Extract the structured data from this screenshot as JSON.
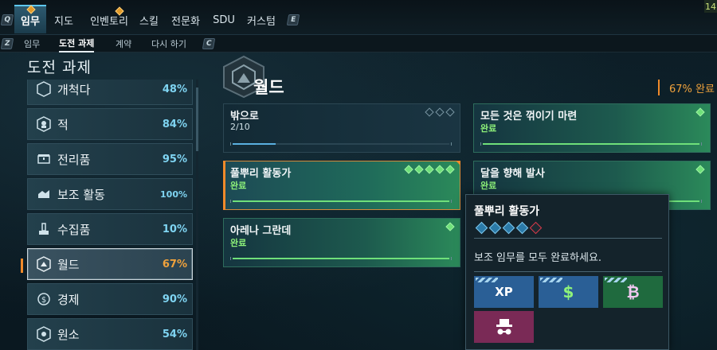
{
  "topnav": {
    "left_key": "Q",
    "right_key": "E",
    "corner": "14",
    "tabs": [
      "임무",
      "지도",
      "인벤토리",
      "스킬",
      "전문화",
      "SDU",
      "커스텀"
    ]
  },
  "subnav": {
    "left_key": "Z",
    "right_key": "C",
    "tabs": [
      "임무",
      "도전 과제",
      "계약",
      "다시 하기"
    ]
  },
  "section_title": "도전 과제",
  "categories": [
    {
      "label": "개척다",
      "pct": "48%",
      "icon": "pioneer-icon"
    },
    {
      "label": "적",
      "pct": "84%",
      "icon": "enemy-icon"
    },
    {
      "label": "전리품",
      "pct": "95%",
      "icon": "loot-icon"
    },
    {
      "label": "보조 활동",
      "pct": "100%",
      "icon": "side-activity-icon"
    },
    {
      "label": "수집품",
      "pct": "10%",
      "icon": "collectible-icon"
    },
    {
      "label": "월드",
      "pct": "67%",
      "icon": "world-icon"
    },
    {
      "label": "경제",
      "pct": "90%",
      "icon": "economy-icon"
    },
    {
      "label": "원소",
      "pct": "54%",
      "icon": "element-icon"
    }
  ],
  "zone": {
    "title": "월드",
    "completion": "67% 완료"
  },
  "challenges": [
    {
      "title": "밖으로",
      "sub": "2/10",
      "progress": 0.2,
      "pips": [
        false,
        false,
        false
      ],
      "state": "progress"
    },
    {
      "title": "모든 것은 꺾이기 마련",
      "sub": "완료",
      "progress": 1,
      "pips": [
        true
      ],
      "state": "done"
    },
    {
      "title": "풀뿌리 활동가",
      "sub": "완료",
      "progress": 1,
      "pips": [
        true,
        true,
        true,
        true,
        true
      ],
      "state": "highlight"
    },
    {
      "title": "달을 향해 발사",
      "sub": "완료",
      "progress": 1,
      "pips": [
        true
      ],
      "state": "done"
    },
    {
      "title": "아레나 그란데",
      "sub": "완료",
      "progress": 1,
      "pips": [
        true
      ],
      "state": "done"
    }
  ],
  "tooltip": {
    "title": "풀뿌리 활동가",
    "description": "보조 임무를 모두 완료하세요.",
    "tiers": 5,
    "rewards": [
      {
        "name": "xp-reward",
        "label": "XP",
        "color": "#2a5f96"
      },
      {
        "name": "money-reward",
        "label": "$",
        "color": "#2a5f96"
      },
      {
        "name": "premium-currency-reward",
        "label": "₿",
        "color": "#1f6a3e"
      },
      {
        "name": "cosmetic-reward",
        "label": "",
        "color": "#7a2a56"
      }
    ]
  },
  "colors": {
    "accent": "#5ec8f0",
    "complete": "#6fe07a",
    "selected": "#f0a23c"
  }
}
